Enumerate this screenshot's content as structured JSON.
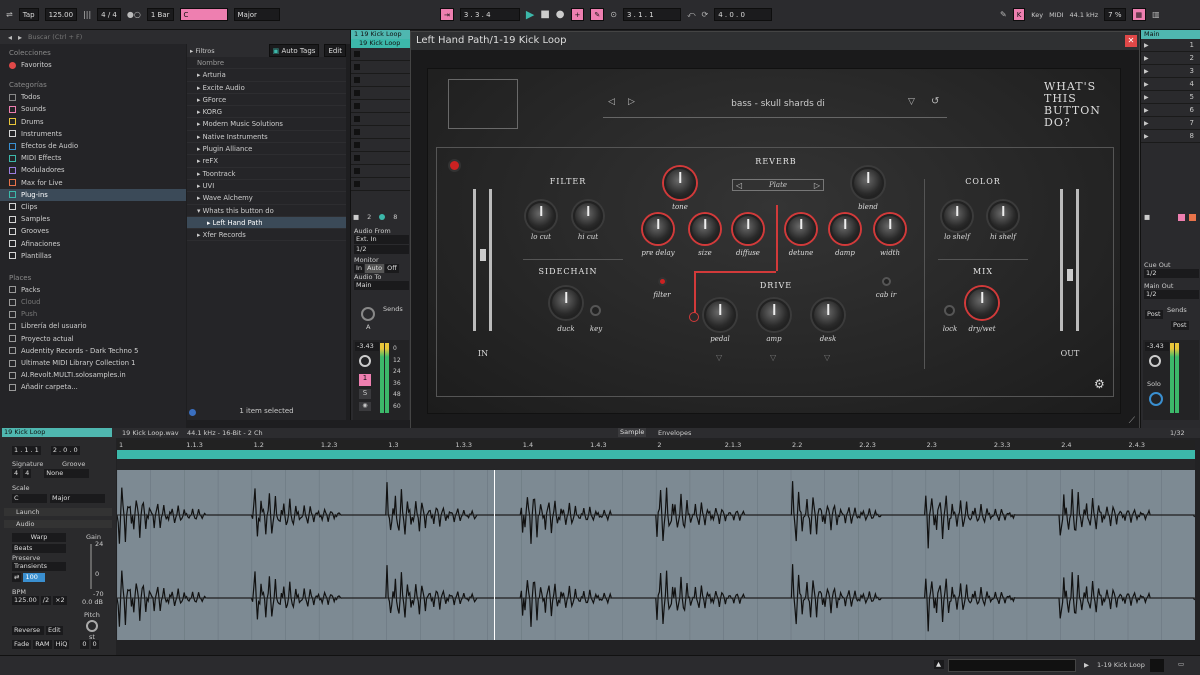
{
  "colors": {
    "accent_pink": "#ee7fb0",
    "accent_teal": "#3cb8aa",
    "clip_teal": "#4fb7b0",
    "plugin_red": "#d23a3a"
  },
  "topbar": {
    "tap": "Tap",
    "bpm": "125.00",
    "time_sig": "4 / 4",
    "quantize": "1 Bar",
    "key_root": "C",
    "key_scale": "Major",
    "position": "3 .  3 .  4",
    "loop_start": "3 .  1 .  1",
    "loop_length": "4 .  0 .  0",
    "key_label": "Key",
    "midi_label": "MIDI",
    "sample_rate": "44.1 kHz",
    "cpu": "7 %"
  },
  "browser": {
    "search_placeholder": "Buscar (Ctrl + F)",
    "collections_title": "Colecciones",
    "favorites": "Favoritos",
    "categories_title": "Categorías",
    "categories": [
      "Todos",
      "Sounds",
      "Drums",
      "Instruments",
      "Efectos de Audio",
      "MIDI Effects",
      "Moduladores",
      "Max for Live",
      "Plug-ins",
      "Clips",
      "Samples",
      "Grooves",
      "Afinaciones",
      "Plantillas"
    ],
    "places_title": "Places",
    "places": [
      "Packs",
      "Cloud",
      "Push",
      "Librería del usuario",
      "Proyecto actual",
      "Audentity Records - Dark Techno 5",
      "Ultimate MIDI Library Collection 1",
      "AI.Revolt.MULTI.solosamples.in",
      "Añadir carpeta..."
    ],
    "filters_label": "Filtros",
    "auto_tags": "Auto Tags",
    "edit": "Edit",
    "name_header": "Nombre",
    "vendors": [
      "Arturia",
      "Excite Audio",
      "GForce",
      "KORG",
      "Modern Music Solutions",
      "Native Instruments",
      "Plugin Alliance",
      "reFX",
      "Toontrack",
      "UVI",
      "Wave Alchemy",
      "Whats this button do",
      "Left Hand Path",
      "Xfer Records"
    ],
    "status": "1 item selected"
  },
  "track": {
    "clip_name": "1 19 Kick Loop",
    "clip_name2": "19 Kick Loop",
    "audio_from": "Audio From",
    "audio_from_val": "Ext. In",
    "audio_from_ch": "1/2",
    "monitor": "Monitor",
    "monitor_in": "In",
    "monitor_auto": "Auto",
    "monitor_off": "Off",
    "audio_to": "Audio To",
    "audio_to_val": "Main",
    "sends": "Sends",
    "send_a": "A",
    "volume": "-3.43",
    "track_num": "1",
    "solo": "S",
    "num2": "2",
    "num8": "8",
    "meter_ticks": [
      "0",
      "12",
      "24",
      "36",
      "48",
      "60"
    ]
  },
  "plugin": {
    "window_title": "Left Hand Path/1-19 Kick Loop",
    "preset": "bass - skull shards di",
    "brand": "WHAT'S THIS BUTTON DO?",
    "sections": {
      "filter": "FILTER",
      "sidechain": "SIDECHAIN",
      "reverb": "REVERB",
      "drive": "DRIVE",
      "color": "COLOR",
      "mix": "MIX"
    },
    "reverb_type": "Plate",
    "knobs": {
      "lo_cut": "lo cut",
      "hi_cut": "hi cut",
      "duck": "duck",
      "key": "key",
      "tone": "tone",
      "blend": "blend",
      "pre_delay": "pre delay",
      "size": "size",
      "diffuse": "diffuse",
      "detune": "detune",
      "damp": "damp",
      "width": "width",
      "filter": "filter",
      "cab_ir": "cab ir",
      "pedal": "pedal",
      "amp": "amp",
      "desk": "desk",
      "lo_shelf": "lo shelf",
      "hi_shelf": "hi shelf",
      "lock": "lock",
      "dry_wet": "dry/wet"
    },
    "in_label": "IN",
    "out_label": "OUT"
  },
  "right": {
    "main": "Main",
    "slots": [
      "1",
      "2",
      "3",
      "4",
      "5",
      "6",
      "7",
      "8"
    ],
    "cue_out": "Cue Out",
    "cue_val": "1/2",
    "main_out": "Main Out",
    "main_val": "1/2",
    "sends": "Sends",
    "post": "Post",
    "volume": "-3.43",
    "solo": "Solo"
  },
  "clip": {
    "tab": "19 Kick Loop",
    "file_info": "19 Kick Loop.wav",
    "rate": "44.1 kHz - 16-Bit - 2 Ch",
    "sample_tab": "Sample",
    "envelopes_tab": "Envelopes",
    "zoom": "1/32",
    "position": "1 .  1 .  1",
    "length": "2 .  0 .  0",
    "signature": "Signature",
    "sig_num": "4",
    "sig_den": "4",
    "groove": "Groove",
    "groove_val": "None",
    "scale": "Scale",
    "scale_root": "C",
    "scale_type": "Major",
    "launch": "Launch",
    "audio": "Audio",
    "warp": "Warp",
    "warp_mode": "Beats",
    "preserve": "Preserve",
    "preserve_val": "Transients",
    "gain": "Gain",
    "gain_top": "24",
    "gain_zero": "0",
    "gain_bottom": "-70",
    "gain_db": "0.0 dB",
    "transient_val": "100",
    "bpm_label": "BPM",
    "bpm_val": "125.00",
    "half": "/2",
    "double": "×2",
    "reverse": "Reverse",
    "edit": "Edit",
    "fade": "Fade",
    "ram": "RAM",
    "hiq": "HiQ",
    "pitch": "Pitch",
    "pitch_st": "st",
    "pitch_a": "0",
    "pitch_b": "0",
    "ruler": [
      "1",
      "1.1.3",
      "1.2",
      "1.2.3",
      "1.3",
      "1.3.3",
      "1.4",
      "1.4.3",
      "2",
      "2.1.3",
      "2.2",
      "2.2.3",
      "2.3",
      "2.3.3",
      "2.4",
      "2.4.3"
    ]
  },
  "status": {
    "clip": "1-19 Kick Loop"
  }
}
